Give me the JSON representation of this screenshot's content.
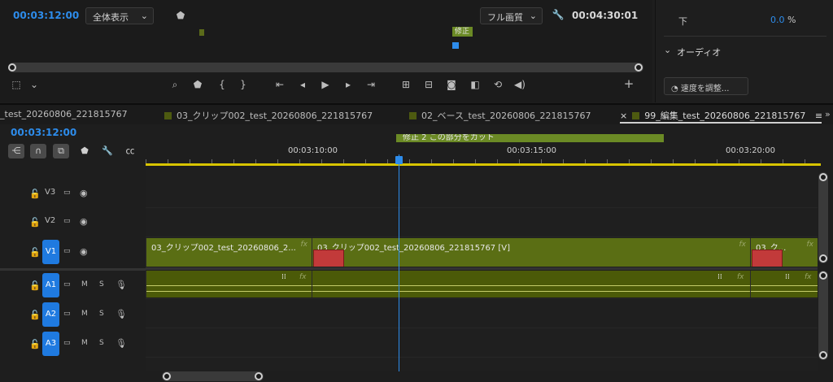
{
  "monitor": {
    "current_time": "00:03:12:00",
    "zoom_select": "全体表示",
    "quality_select": "フル画質",
    "duration": "00:04:30:01",
    "marker_tag": "修正"
  },
  "effects_panel": {
    "row_label": "下",
    "row_value": "0.0",
    "row_unit": "%",
    "section_title": "オーディオ",
    "speed_button": "速度を調整..."
  },
  "tabs": [
    {
      "label": "_test_20260806_221815767"
    },
    {
      "label": "03_クリップ002_test_20260806_221815767"
    },
    {
      "label": "02_ベース_test_20260806_221815767"
    },
    {
      "label": "99_編集_test_20260806_221815767"
    }
  ],
  "timeline": {
    "current_time": "00:03:12:00",
    "ruler_labels": [
      "00:03:10:00",
      "00:03:15:00",
      "00:03:20:00"
    ],
    "marker_comment": "修正 2 この部分をカット",
    "video_tracks": [
      {
        "label": "V3",
        "targeted": false
      },
      {
        "label": "V2",
        "targeted": false
      },
      {
        "label": "V1",
        "targeted": true
      }
    ],
    "audio_tracks": [
      {
        "label": "A1",
        "mute": "M",
        "solo": "S"
      },
      {
        "label": "A2",
        "mute": "M",
        "solo": "S"
      },
      {
        "label": "A3",
        "mute": "M",
        "solo": "S"
      }
    ],
    "video_clips": [
      {
        "name": "03_クリップ002_test_20260806_2...",
        "fx": "fx"
      },
      {
        "name": "03_クリップ002_test_20260806_221815767 [V]",
        "fx": "fx"
      },
      {
        "name": "03_ク...",
        "fx": "fx"
      }
    ],
    "audio_fx": "fx"
  },
  "colors": {
    "accent": "#2d8ceb",
    "clip_video": "#5a6e14",
    "clip_audio": "#4b5a08",
    "marker": "#6b8a25",
    "work_area": "#d8c400"
  }
}
